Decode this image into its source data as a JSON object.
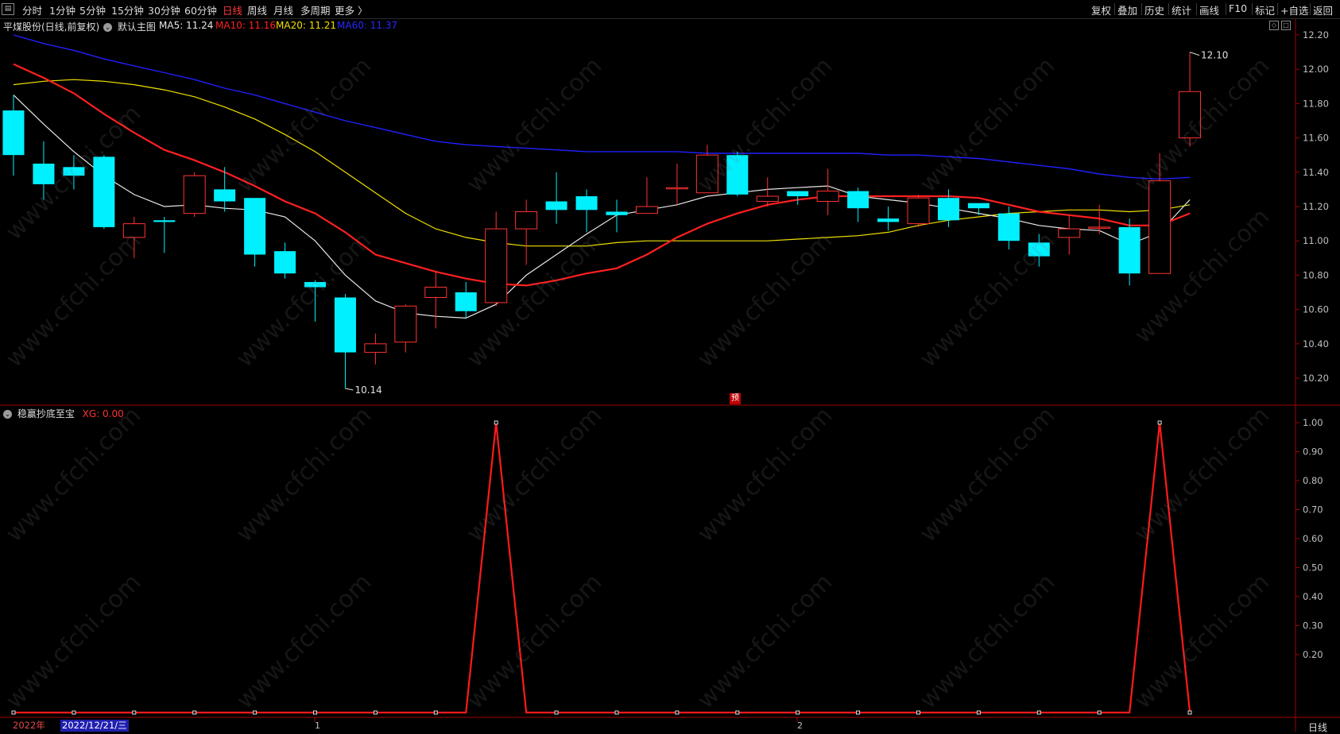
{
  "toolbar": {
    "periods": [
      "分时",
      "1分钟",
      "5分钟",
      "15分钟",
      "30分钟",
      "60分钟",
      "日线",
      "周线",
      "月线",
      "多周期",
      "更多 〉"
    ],
    "active_period": "日线",
    "right_buttons": [
      "复权",
      "叠加",
      "历史",
      "统计",
      "画线",
      "F10",
      "标记",
      "+自选",
      "返回"
    ]
  },
  "main_chart": {
    "title": "平煤股份(日线,前复权)",
    "template": "默认主图",
    "ma5": "MA5: 11.24",
    "ma10": "MA10: 11.16",
    "ma20": "MA20: 11.21",
    "ma60": "MA60: 11.37",
    "high_label": "12.10",
    "low_label": "10.14",
    "pre_tag": "预"
  },
  "indicator": {
    "name": "稳赢抄底至宝",
    "value": "XG: 0.00"
  },
  "axis": {
    "main_ticks": [
      "12.20",
      "12.00",
      "11.80",
      "11.60",
      "11.40",
      "11.20",
      "11.00",
      "10.80",
      "10.60",
      "10.40",
      "10.20"
    ],
    "indicator_ticks": [
      "1.00",
      "0.90",
      "0.80",
      "0.70",
      "0.60",
      "0.50",
      "0.40",
      "0.30",
      "0.20"
    ]
  },
  "bottom_bar": {
    "year": "2022年",
    "cursor_date": "2022/12/21/三",
    "month_marks": [
      "1",
      "2"
    ],
    "period": "日线"
  },
  "watermark": "www.cfchi.com",
  "colors": {
    "up": "#ff3232",
    "down": "#00f0ff",
    "ma5": "#e8e8e8",
    "ma10": "#ff2020",
    "ma20": "#f0e000",
    "ma60": "#2020ff",
    "axis_red": "#a00000"
  },
  "chart_data": {
    "type": "candlestick",
    "price_range": [
      10.09,
      12.24
    ],
    "indicator_range": [
      0,
      1.05
    ],
    "candles": [
      {
        "o": 11.76,
        "h": 11.85,
        "l": 11.38,
        "c": 11.5
      },
      {
        "o": 11.45,
        "h": 11.58,
        "l": 11.24,
        "c": 11.33
      },
      {
        "o": 11.43,
        "h": 11.5,
        "l": 11.3,
        "c": 11.38
      },
      {
        "o": 11.49,
        "h": 11.5,
        "l": 11.07,
        "c": 11.08
      },
      {
        "o": 11.02,
        "h": 11.14,
        "l": 10.9,
        "c": 11.1
      },
      {
        "o": 11.12,
        "h": 11.14,
        "l": 10.93,
        "c": 11.11
      },
      {
        "o": 11.16,
        "h": 11.4,
        "l": 11.14,
        "c": 11.38
      },
      {
        "o": 11.3,
        "h": 11.43,
        "l": 11.17,
        "c": 11.23
      },
      {
        "o": 11.25,
        "h": 11.25,
        "l": 10.85,
        "c": 10.92
      },
      {
        "o": 10.94,
        "h": 10.99,
        "l": 10.78,
        "c": 10.81
      },
      {
        "o": 10.76,
        "h": 10.77,
        "l": 10.53,
        "c": 10.73
      },
      {
        "o": 10.67,
        "h": 10.69,
        "l": 10.14,
        "c": 10.35
      },
      {
        "o": 10.35,
        "h": 10.46,
        "l": 10.28,
        "c": 10.4
      },
      {
        "o": 10.41,
        "h": 10.63,
        "l": 10.35,
        "c": 10.62
      },
      {
        "o": 10.67,
        "h": 10.82,
        "l": 10.49,
        "c": 10.73
      },
      {
        "o": 10.7,
        "h": 10.76,
        "l": 10.55,
        "c": 10.59
      },
      {
        "o": 10.64,
        "h": 11.17,
        "l": 10.62,
        "c": 11.07
      },
      {
        "o": 11.07,
        "h": 11.24,
        "l": 10.86,
        "c": 11.17
      },
      {
        "o": 11.23,
        "h": 11.4,
        "l": 11.1,
        "c": 11.18
      },
      {
        "o": 11.26,
        "h": 11.3,
        "l": 11.05,
        "c": 11.18
      },
      {
        "o": 11.17,
        "h": 11.24,
        "l": 11.05,
        "c": 11.15
      },
      {
        "o": 11.16,
        "h": 11.37,
        "l": 11.16,
        "c": 11.2
      },
      {
        "o": 11.31,
        "h": 11.45,
        "l": 11.21,
        "c": 11.31
      },
      {
        "o": 11.28,
        "h": 11.56,
        "l": 11.28,
        "c": 11.5
      },
      {
        "o": 11.5,
        "h": 11.52,
        "l": 11.26,
        "c": 11.27
      },
      {
        "o": 11.23,
        "h": 11.37,
        "l": 11.2,
        "c": 11.26
      },
      {
        "o": 11.29,
        "h": 11.29,
        "l": 11.21,
        "c": 11.26
      },
      {
        "o": 11.23,
        "h": 11.42,
        "l": 11.15,
        "c": 11.29
      },
      {
        "o": 11.29,
        "h": 11.31,
        "l": 11.11,
        "c": 11.19
      },
      {
        "o": 11.13,
        "h": 11.2,
        "l": 11.06,
        "c": 11.11
      },
      {
        "o": 11.1,
        "h": 11.27,
        "l": 11.08,
        "c": 11.25
      },
      {
        "o": 11.25,
        "h": 11.3,
        "l": 11.08,
        "c": 11.12
      },
      {
        "o": 11.22,
        "h": 11.22,
        "l": 11.15,
        "c": 11.19
      },
      {
        "o": 11.16,
        "h": 11.2,
        "l": 10.95,
        "c": 11.0
      },
      {
        "o": 10.99,
        "h": 11.04,
        "l": 10.85,
        "c": 10.91
      },
      {
        "o": 11.02,
        "h": 11.15,
        "l": 10.92,
        "c": 11.07
      },
      {
        "o": 11.08,
        "h": 11.21,
        "l": 11.04,
        "c": 11.08
      },
      {
        "o": 11.08,
        "h": 11.13,
        "l": 10.74,
        "c": 10.81
      },
      {
        "o": 10.81,
        "h": 11.51,
        "l": 10.81,
        "c": 11.35
      },
      {
        "o": 11.6,
        "h": 12.1,
        "l": 11.55,
        "c": 11.87
      }
    ],
    "ma5": [
      11.85,
      11.68,
      11.52,
      11.38,
      11.27,
      11.2,
      11.21,
      11.19,
      11.18,
      11.14,
      11.0,
      10.8,
      10.65,
      10.58,
      10.56,
      10.55,
      10.63,
      10.8,
      10.92,
      11.04,
      11.15,
      11.18,
      11.21,
      11.26,
      11.28,
      11.3,
      11.31,
      11.32,
      11.26,
      11.24,
      11.22,
      11.19,
      11.16,
      11.13,
      11.09,
      11.07,
      11.06,
      10.98,
      11.05,
      11.24
    ],
    "ma10": [
      12.03,
      11.95,
      11.86,
      11.74,
      11.63,
      11.53,
      11.47,
      11.4,
      11.32,
      11.23,
      11.16,
      11.05,
      10.92,
      10.87,
      10.82,
      10.78,
      10.75,
      10.74,
      10.77,
      10.81,
      10.84,
      10.92,
      11.02,
      11.1,
      11.16,
      11.21,
      11.24,
      11.26,
      11.26,
      11.26,
      11.26,
      11.26,
      11.25,
      11.21,
      11.17,
      11.15,
      11.13,
      11.09,
      11.09,
      11.16
    ],
    "ma20": [
      11.91,
      11.93,
      11.94,
      11.93,
      11.91,
      11.88,
      11.84,
      11.78,
      11.71,
      11.62,
      11.52,
      11.4,
      11.28,
      11.16,
      11.07,
      11.02,
      10.99,
      10.97,
      10.97,
      10.97,
      10.99,
      11.0,
      11.0,
      11.0,
      11.0,
      11.0,
      11.01,
      11.02,
      11.03,
      11.05,
      11.09,
      11.12,
      11.14,
      11.16,
      11.17,
      11.18,
      11.18,
      11.17,
      11.18,
      11.21
    ],
    "ma60": [
      12.2,
      12.15,
      12.11,
      12.06,
      12.02,
      11.98,
      11.94,
      11.89,
      11.85,
      11.8,
      11.75,
      11.7,
      11.66,
      11.62,
      11.58,
      11.56,
      11.55,
      11.54,
      11.53,
      11.52,
      11.52,
      11.52,
      11.52,
      11.51,
      11.51,
      11.51,
      11.51,
      11.51,
      11.51,
      11.5,
      11.5,
      11.49,
      11.48,
      11.46,
      11.44,
      11.42,
      11.39,
      11.37,
      11.36,
      11.37
    ],
    "xg": [
      0,
      0,
      0,
      0,
      0,
      0,
      0,
      0,
      0,
      0,
      0,
      0,
      0,
      0,
      0,
      0,
      1,
      0,
      0,
      0,
      0,
      0,
      0,
      0,
      0,
      0,
      0,
      0,
      0,
      0,
      0,
      0,
      0,
      0,
      0,
      0,
      0,
      0,
      1,
      0
    ]
  }
}
